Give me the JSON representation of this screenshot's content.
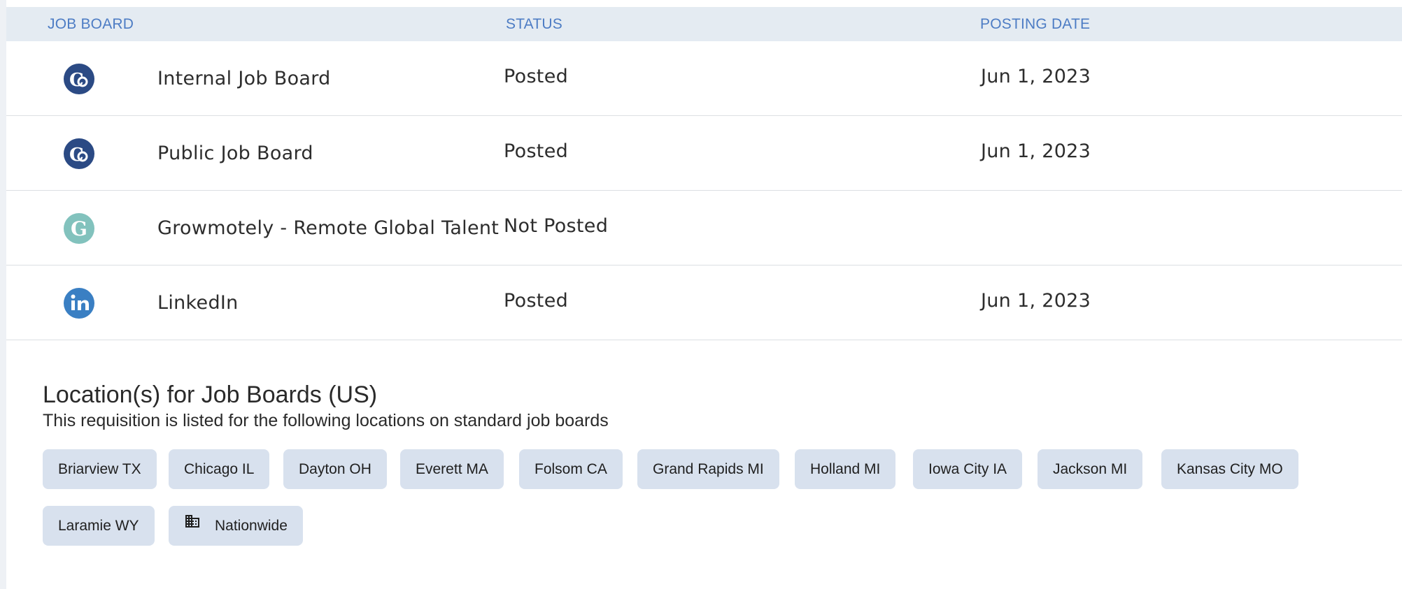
{
  "table": {
    "headers": {
      "job_board": "JOB BOARD",
      "status": "STATUS",
      "posting_date": "POSTING DATE"
    },
    "rows": [
      {
        "logo": "company-co-icon",
        "name": "Internal Job Board",
        "status": "Posted",
        "date": "Jun 1, 2023"
      },
      {
        "logo": "company-co-icon",
        "name": "Public Job Board",
        "status": "Posted",
        "date": "Jun 1, 2023"
      },
      {
        "logo": "growmotely-g-icon",
        "name": "Growmotely - Remote Global Talent",
        "status": "Not Posted",
        "date": ""
      },
      {
        "logo": "linkedin-icon",
        "name": "LinkedIn",
        "status": "Posted",
        "date": "Jun 1, 2023"
      }
    ]
  },
  "locations": {
    "title": "Location(s) for Job Boards (US)",
    "subtitle": "This requisition is listed for the following locations on standard job boards",
    "chips": [
      {
        "label": "Briarview TX"
      },
      {
        "label": "Chicago IL"
      },
      {
        "label": "Dayton OH"
      },
      {
        "label": "Everett MA"
      },
      {
        "label": "Folsom CA"
      },
      {
        "label": "Grand Rapids MI"
      },
      {
        "label": "Holland MI"
      },
      {
        "label": "Iowa City IA"
      },
      {
        "label": "Jackson MI"
      },
      {
        "label": "Kansas City MO"
      },
      {
        "label": "Laramie WY"
      },
      {
        "label": "Nationwide",
        "icon": "building-icon"
      }
    ]
  },
  "colors": {
    "header_bg": "#e4ebf2",
    "header_text": "#4d7cc4",
    "chip_bg": "#d8e1ee",
    "company_logo": "#2b4a84",
    "growmotely_logo": "#82c2bd",
    "linkedin_logo": "#3a7fc3"
  }
}
